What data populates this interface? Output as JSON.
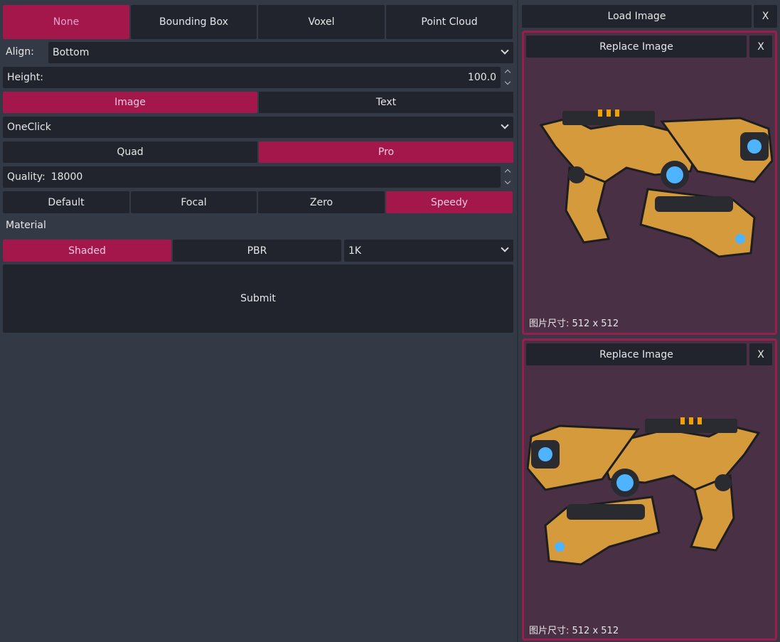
{
  "mode_tabs": [
    "None",
    "Bounding Box",
    "Voxel",
    "Point Cloud"
  ],
  "align": {
    "label": "Align:",
    "value": "Bottom"
  },
  "height": {
    "label": "Height:",
    "value": "100.0"
  },
  "input_tabs": [
    "Image",
    "Text"
  ],
  "model_select": {
    "value": "OneClick"
  },
  "topology_tabs": [
    "Quad",
    "Pro"
  ],
  "quality": {
    "label": "Quality:",
    "value": "18000"
  },
  "preset_tabs": [
    "Default",
    "Focal",
    "Zero",
    "Speedy"
  ],
  "material": {
    "label": "Material",
    "tabs": [
      "Shaded",
      "PBR"
    ],
    "resolution": "1K"
  },
  "submit_label": "Submit",
  "right": {
    "load_image_label": "Load Image",
    "close_label": "X",
    "panels": [
      {
        "replace_label": "Replace Image",
        "close_label": "X",
        "caption": "图片尺寸: 512 x 512"
      },
      {
        "replace_label": "Replace Image",
        "close_label": "X",
        "caption": "图片尺寸: 512 x 512"
      }
    ]
  },
  "colors": {
    "accent": "#a3174a",
    "background": "#343946",
    "control": "#21242c",
    "panel": "#4a3045"
  }
}
